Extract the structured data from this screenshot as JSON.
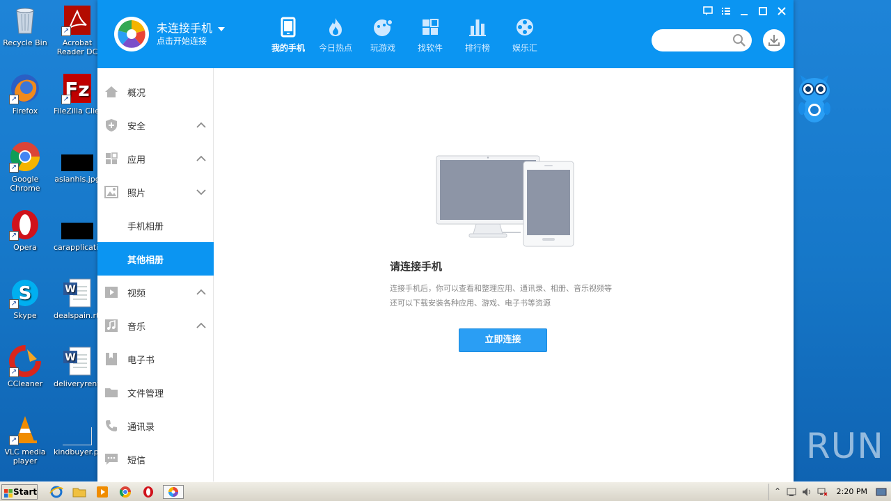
{
  "desktop": {
    "icons": [
      {
        "label": "Recycle Bin"
      },
      {
        "label": "Acrobat Reader DC"
      },
      {
        "label": "Firefox"
      },
      {
        "label": "FileZilla Client"
      },
      {
        "label": "Google Chrome"
      },
      {
        "label": "asianhis.jpg"
      },
      {
        "label": "Opera"
      },
      {
        "label": "carapplicati..."
      },
      {
        "label": "Skype"
      },
      {
        "label": "dealspain.rtf"
      },
      {
        "label": "CCleaner"
      },
      {
        "label": "deliveryrent..."
      },
      {
        "label": "VLC media player"
      },
      {
        "label": "kindbuyer.png"
      }
    ],
    "watermark": "ANY RUN"
  },
  "app": {
    "header": {
      "connection_title": "未连接手机",
      "connection_subtitle": "点击开始连接"
    },
    "nav": [
      {
        "label": "我的手机",
        "icon": "phone-icon",
        "active": true
      },
      {
        "label": "今日热点",
        "icon": "flame-icon"
      },
      {
        "label": "玩游戏",
        "icon": "gamepad-icon"
      },
      {
        "label": "找软件",
        "icon": "apps-grid-icon"
      },
      {
        "label": "排行榜",
        "icon": "bar-chart-icon"
      },
      {
        "label": "娱乐汇",
        "icon": "film-reel-icon"
      }
    ],
    "search": {
      "placeholder": ""
    },
    "sidebar": [
      {
        "label": "概况",
        "icon": "home-icon"
      },
      {
        "label": "安全",
        "icon": "shield-icon",
        "chevron": "up"
      },
      {
        "label": "应用",
        "icon": "apps-icon",
        "chevron": "up"
      },
      {
        "label": "照片",
        "icon": "image-icon",
        "chevron": "down"
      },
      {
        "label": "手机相册"
      },
      {
        "label": "其他相册",
        "active": true
      },
      {
        "label": "视频",
        "icon": "play-icon",
        "chevron": "up"
      },
      {
        "label": "音乐",
        "icon": "music-icon",
        "chevron": "up"
      },
      {
        "label": "电子书",
        "icon": "book-icon"
      },
      {
        "label": "文件管理",
        "icon": "folder-icon"
      },
      {
        "label": "通讯录",
        "icon": "phone-call-icon"
      },
      {
        "label": "短信",
        "icon": "message-icon"
      }
    ],
    "main": {
      "title": "请连接手机",
      "desc_line1": "连接手机后，你可以查看和整理应用、通讯录、相册、音乐视频等",
      "desc_line2": "还可以下载安装各种应用、游戏、电子书等资源",
      "connect_button": "立即连接"
    }
  },
  "taskbar": {
    "start_label": "Start",
    "clock": "2:20 PM"
  },
  "colors": {
    "accent": "#0b95f2",
    "button": "#2a9ef4"
  }
}
